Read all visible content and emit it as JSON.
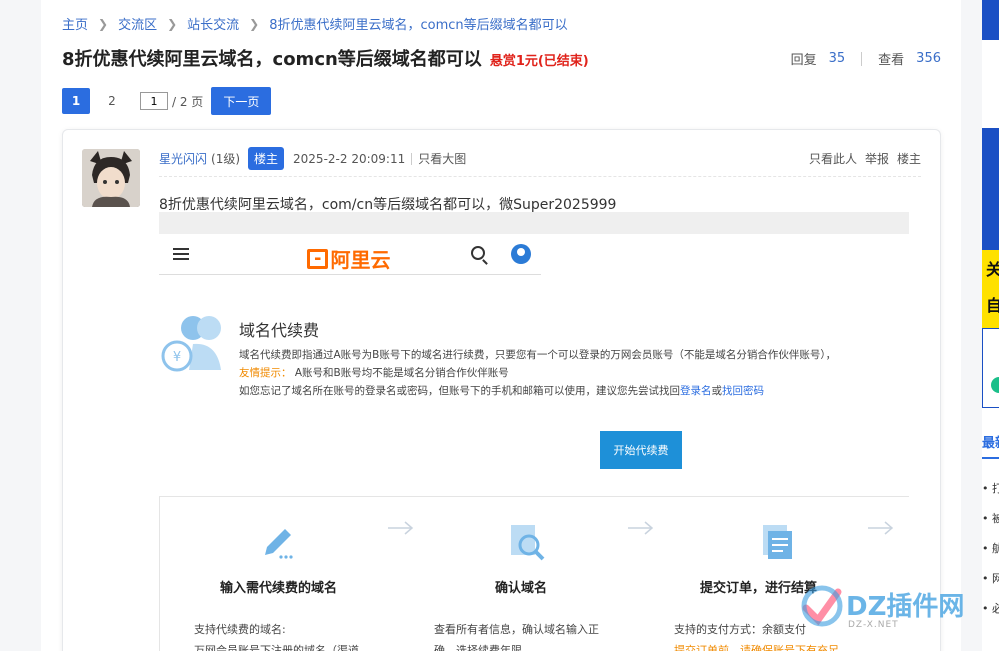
{
  "breadcrumb": {
    "home": "主页",
    "forum": "交流区",
    "board": "站长交流",
    "current": "8折优惠代续阿里云域名，comcn等后缀域名都可以"
  },
  "thread": {
    "title": "8折优惠代续阿里云域名，comcn等后缀域名都可以",
    "reward": "悬赏1元(已结束)",
    "replies_label": "回复",
    "replies": "35",
    "views_label": "查看",
    "views": "356"
  },
  "pager": {
    "page1": "1",
    "page2": "2",
    "input_value": "1",
    "total": "/ 2 页",
    "next": "下一页"
  },
  "post": {
    "author": "星光闪闪",
    "level": "(1级)",
    "owner_badge": "楼主",
    "time": "2025-2-2 20:09:11",
    "only_image": "只看大图",
    "only_author": "只看此人",
    "report": "举报",
    "floor": "楼主",
    "text": "8折优惠代续阿里云域名，com/cn等后缀域名都可以，微Super2025999"
  },
  "screenshot": {
    "logo_text": "阿里云",
    "title": "域名代续费",
    "desc_line1": "域名代续费即指通过A账号为B账号下的域名进行续费，只要您有一个可以登录的万网会员账号（不能是域名分销合作伙伴账号），",
    "tip_label": "友情提示：",
    "desc_line2": "A账号和B账号均不能是域名分销合作伙伴账号",
    "desc_line3_pre": "如您忘记了域名所在账号的登录名或密码，但账号下的手机和邮箱可以使用，建议您先尝试找回",
    "link_login": "登录名",
    "or_text": "或",
    "link_password": "找回密码",
    "start_button": "开始代续费",
    "steps": [
      {
        "title": "输入需代续费的域名",
        "desc1": "支持代续费的域名:",
        "desc2": "万网会员账号下注册的域名（渠道"
      },
      {
        "title": "确认域名",
        "desc1": "查看所有者信息，确认域名输入正",
        "desc2": "确，选择续费年限。"
      },
      {
        "title": "提交订单，进行结算",
        "desc1": "支持的支付方式：余额支付",
        "desc2": "提交订单前，请确保账号下有充足"
      }
    ]
  },
  "rail": {
    "yellow_line1": "关",
    "yellow_line2": "自",
    "heading": "最新",
    "items": [
      "打",
      "被",
      "航",
      "网",
      "必"
    ]
  },
  "watermark": {
    "text": "DZ插件网",
    "sub": "DZ-X.NET"
  },
  "colors": {
    "accent": "#2b6de0",
    "reward": "#e0231b",
    "aliyun_orange": "#ff6a00",
    "button_blue": "#1e90d8"
  }
}
